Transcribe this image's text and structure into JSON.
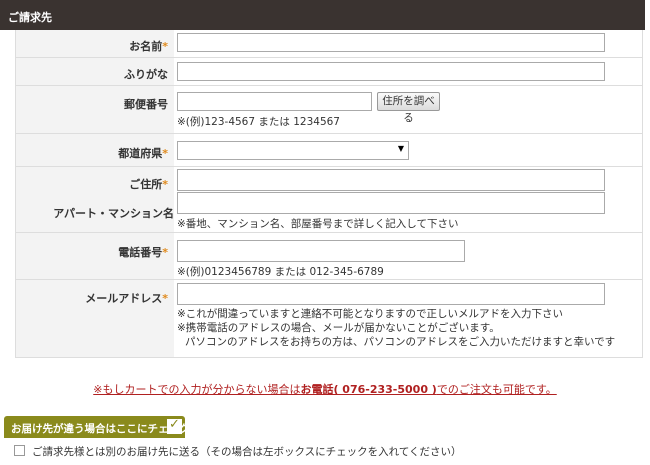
{
  "section": {
    "title": "ご請求先"
  },
  "form": {
    "name": {
      "label": "お名前",
      "required_mark": "*"
    },
    "furigana": {
      "label": "ふりがな"
    },
    "postal": {
      "label": "郵便番号",
      "lookup_button": "住所を調べる",
      "hint": "※(例)123-4567 または 1234567"
    },
    "prefecture": {
      "label": "都道府県",
      "required_mark": "*"
    },
    "address": {
      "label": "ご住所",
      "required_mark": "*",
      "apartment_label": "アパート・マンション名",
      "hint": "※番地、マンション名、部屋番号まで詳しく記入して下さい"
    },
    "phone": {
      "label": "電話番号",
      "required_mark": "*",
      "hint": "※(例)0123456789 または 012-345-6789"
    },
    "email": {
      "label": "メールアドレス",
      "required_mark": "*",
      "hint1": "※これが間違っていますと連絡不可能となりますので正しいメルアドを入力下さい",
      "hint2": "※携帯電話のアドレスの場合、メールが届かないことがございます。",
      "hint3": "パソコンのアドレスをお持ちの方は、パソコンのアドレスをご入力いただけますと幸いです"
    }
  },
  "phone_note": {
    "prefix": "※もしカートでの入力が分からない場合は",
    "phone": "お電話( 076-233-5000 )",
    "suffix": "でのご注文も可能です。"
  },
  "delivery": {
    "tab_label": "お届け先が違う場合はここにチェック",
    "checkbox_label": "ご請求先様とは別のお届け先に送る（その場合は左ボックスにチェックを入れてください）"
  },
  "icons": {
    "select_arrow": "▼",
    "check": "✓"
  },
  "colors": {
    "header_bg": "#3a3330",
    "required": "#e08a1c",
    "note_red": "#b02020",
    "tab_olive": "#8a8a1c"
  }
}
